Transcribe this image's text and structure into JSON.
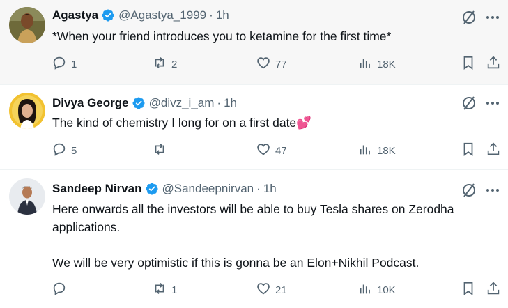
{
  "tweets": [
    {
      "name": "Agastya",
      "handle": "@Agastya_1999",
      "separator": "·",
      "time": "1h",
      "text": "*When your friend introduces you to ketamine for the first time*",
      "replies": "1",
      "reposts": "2",
      "likes": "77",
      "views": "18K"
    },
    {
      "name": "Divya George",
      "handle": "@divz_i_am",
      "separator": "·",
      "time": "1h",
      "text": "The kind of chemistry I long for on a first date💕",
      "replies": "5",
      "reposts": "",
      "likes": "47",
      "views": "18K"
    },
    {
      "name": "Sandeep Nirvan",
      "handle": "@Sandeepnirvan",
      "separator": "·",
      "time": "1h",
      "text": "Here onwards all the investors will be able to buy Tesla shares on Zerodha applications.\n\nWe will be very optimistic if this is gonna be an Elon+Nikhil Podcast.",
      "replies": "",
      "reposts": "1",
      "likes": "21",
      "views": "10K"
    }
  ],
  "colors": {
    "verified": "#1d9bf0",
    "muted": "#536471",
    "text": "#0f1419",
    "hover_bg": "#f7f7f7",
    "divider": "#eff3f4"
  },
  "icons": [
    "verified-badge-icon",
    "grok-icon",
    "more-icon",
    "reply-icon",
    "repost-icon",
    "like-icon",
    "views-icon",
    "bookmark-icon",
    "share-icon"
  ]
}
